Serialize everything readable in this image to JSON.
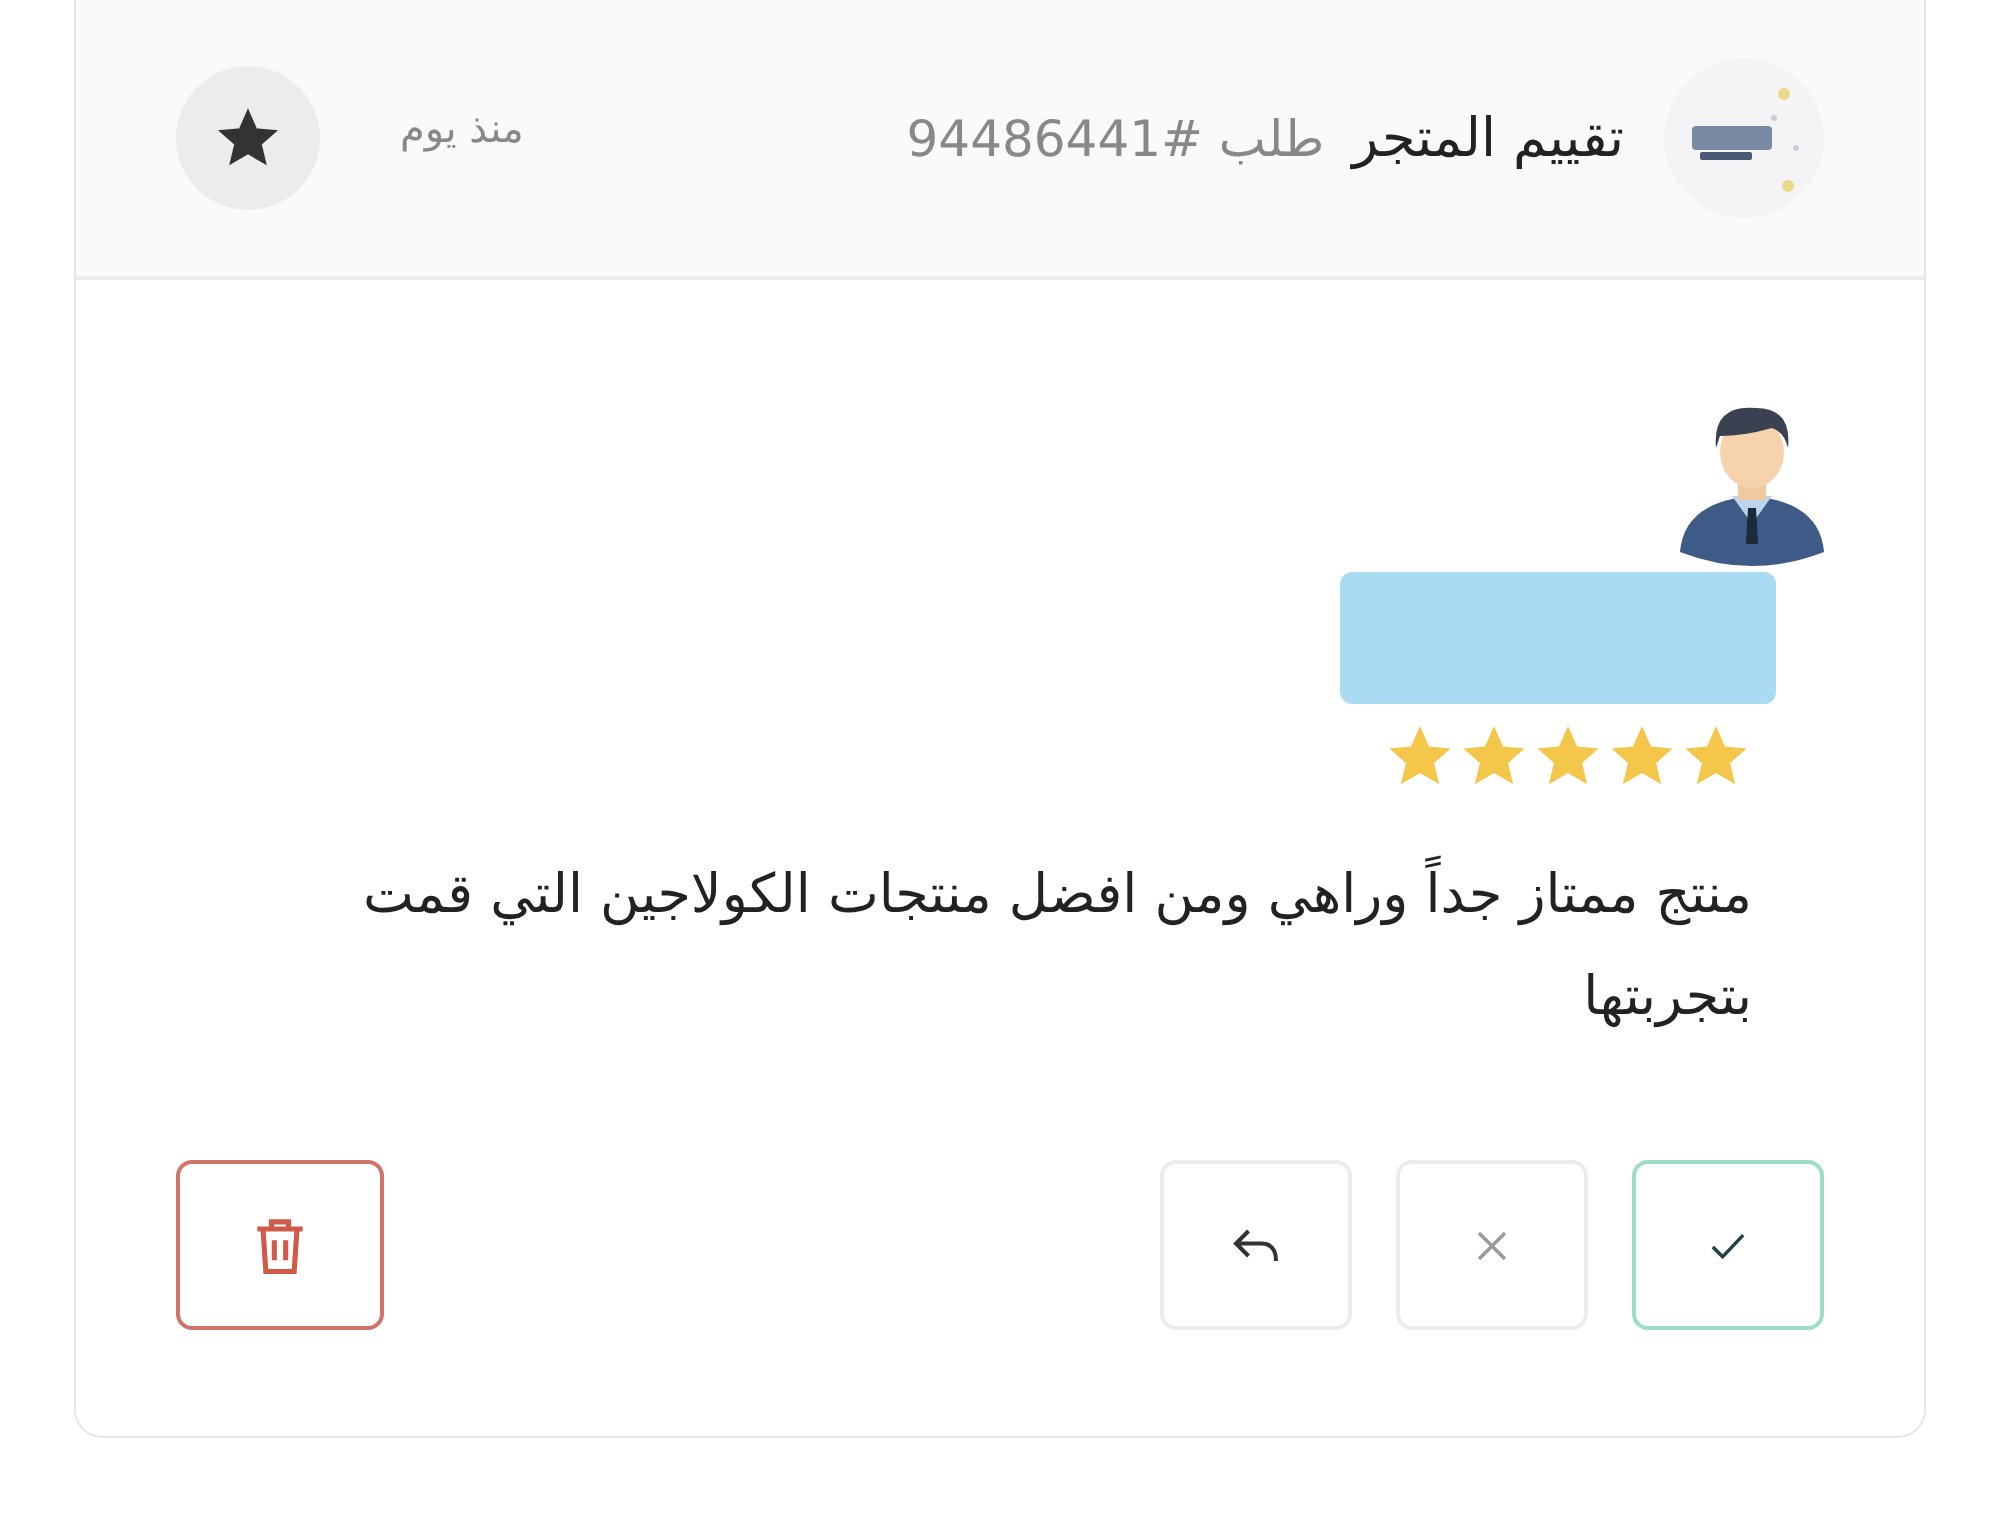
{
  "header": {
    "title": "تقييم المتجر",
    "order": "طلب #94486441",
    "time": "منذ يوم",
    "starred": true
  },
  "review": {
    "name_redacted": true,
    "stars": 5,
    "text": "منتج ممتاز جداً وراهي ومن افضل منتجات الكولاجين التي قمت بتجربتها"
  },
  "actions": [
    {
      "kind": "approve"
    },
    {
      "kind": "reject"
    },
    {
      "kind": "reply"
    },
    {
      "kind": "delete"
    }
  ]
}
